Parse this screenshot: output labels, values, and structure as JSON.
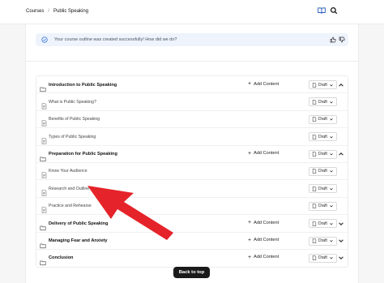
{
  "breadcrumb": {
    "root": "Courses",
    "separator": "/",
    "current": "Public Speaking"
  },
  "banner": {
    "message": "Your course outline was created successfully! How did we do?"
  },
  "outline": {
    "add_label": "Add Content",
    "status_label": "Draft",
    "rows": [
      {
        "kind": "section",
        "title": "Introduction to Public Speaking",
        "expanded": true
      },
      {
        "kind": "lesson",
        "title": "What is Public Speaking?"
      },
      {
        "kind": "lesson",
        "title": "Benefits of Public Speaking"
      },
      {
        "kind": "lesson",
        "title": "Types of Public Speaking"
      },
      {
        "kind": "section",
        "title": "Preparation for Public Speaking",
        "expanded": true
      },
      {
        "kind": "lesson",
        "title": "Know Your Audience"
      },
      {
        "kind": "lesson",
        "title": "Research and Outline"
      },
      {
        "kind": "lesson",
        "title": "Practice and Rehearse"
      },
      {
        "kind": "section",
        "title": "Delivery of Public Speaking",
        "expanded": false
      },
      {
        "kind": "section",
        "title": "Managing Fear and Anxiety",
        "expanded": false
      },
      {
        "kind": "section",
        "title": "Conclusion",
        "expanded": false
      }
    ]
  },
  "back_to_top": "Back to top",
  "colors": {
    "arrow": "#e5232a",
    "banner_bg": "#eef3fc",
    "button_dark": "#1a1a1a"
  }
}
